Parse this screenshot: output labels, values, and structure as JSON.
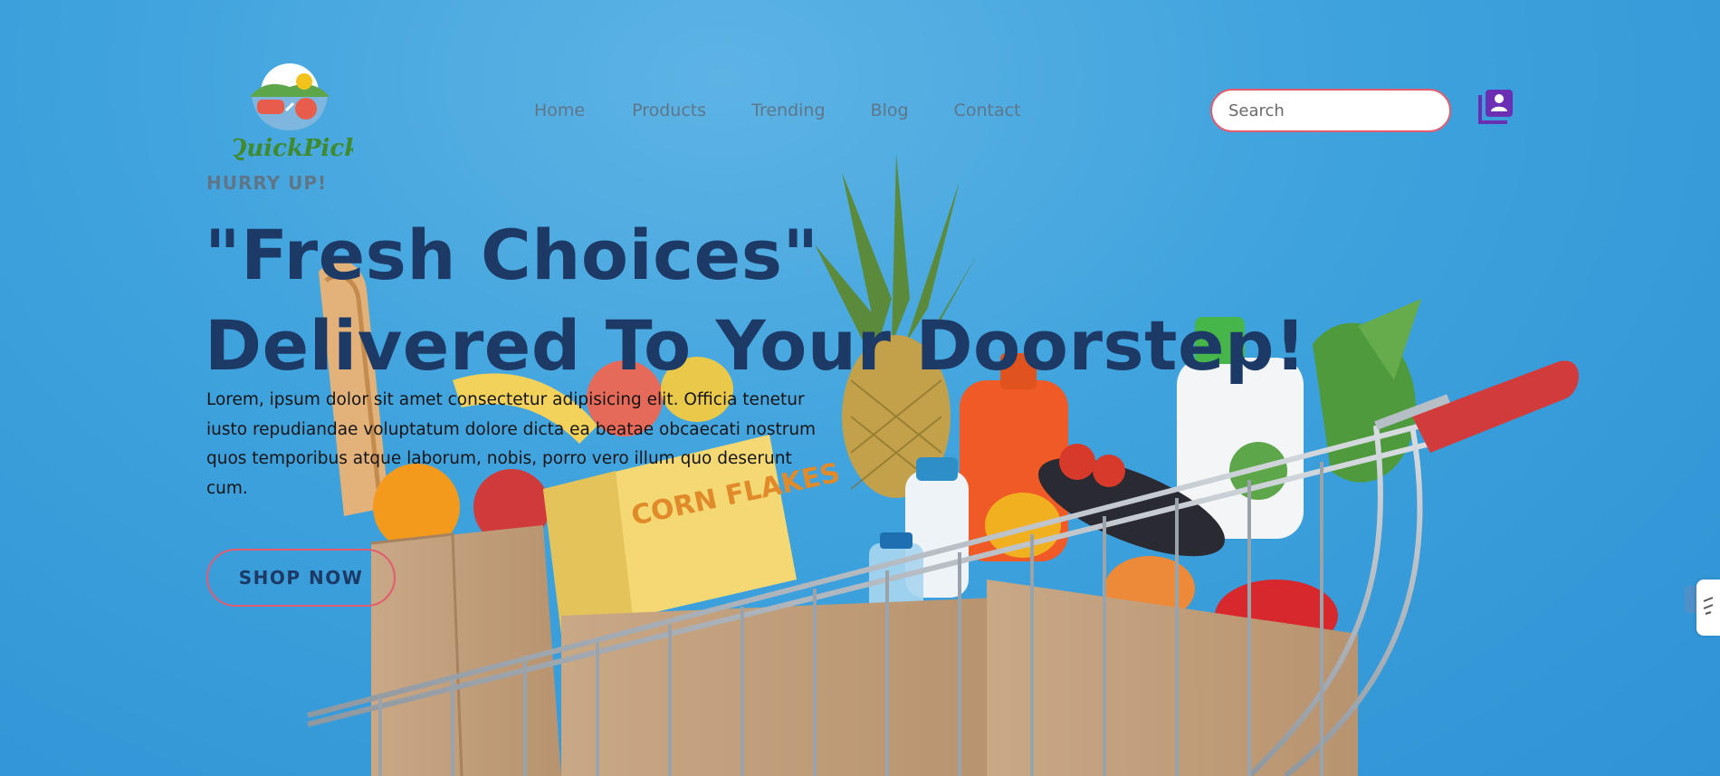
{
  "brand": {
    "name": "QuickPick"
  },
  "nav": {
    "items": [
      "Home",
      "Products",
      "Trending",
      "Blog",
      "Contact"
    ]
  },
  "search": {
    "placeholder": "Search",
    "value": ""
  },
  "hero": {
    "eyebrow": "HURRY UP!",
    "headline_line1": "\"Fresh Choices\"",
    "headline_line2": "Delivered To Your Doorstep!",
    "description": "Lorem, ipsum dolor sit amet consectetur adipisicing elit. Officia tenetur iusto repudiandae voluptatum dolore dicta ea beatae obcaecati nostrum quos temporibus atque laborum, nobis, porro vero illum quo deserunt cum.",
    "cta_label": "SHOP NOW",
    "image_text": "CORN FLAKES"
  },
  "icons": {
    "account": "user-library-icon",
    "side_widget": "accessibility-icon"
  },
  "colors": {
    "background": "#3ea2dd",
    "headline": "#1d3a66",
    "nav_text": "#5f7688",
    "accent_border": "#e25b6f",
    "icon_purple": "#6a2fb3",
    "cart_handle": "#d23b3b"
  }
}
